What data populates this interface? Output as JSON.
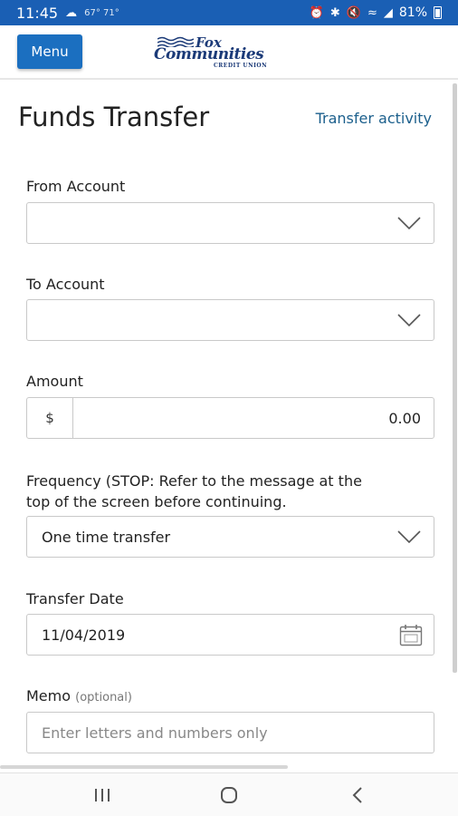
{
  "status": {
    "time": "11:45",
    "weather": "67° 71°",
    "battery": "81%"
  },
  "header": {
    "menu_label": "Menu",
    "logo_word1": "Fox",
    "logo_word2": "Communities",
    "logo_sub": "CREDIT UNION"
  },
  "page": {
    "title": "Funds Transfer",
    "activity_link": "Transfer activity"
  },
  "form": {
    "from_label": "From Account",
    "from_value": "",
    "to_label": "To Account",
    "to_value": "",
    "amount_label": "Amount",
    "amount_prefix": "$",
    "amount_value": "0.00",
    "frequency_label_line1": "Frequency (STOP: Refer to the message at the",
    "frequency_label_line2": "top of the screen before continuing.",
    "frequency_value": "One time transfer",
    "date_label": "Transfer Date",
    "date_value": "11/04/2019",
    "memo_label": "Memo",
    "memo_optional": "(optional)",
    "memo_placeholder": "Enter letters and numbers only"
  },
  "icons": {
    "dropdown": "chevron-down-icon",
    "calendar": "calendar-icon",
    "nav_recent": "recent-apps-icon",
    "nav_home": "home-icon",
    "nav_back": "back-icon"
  },
  "colors": {
    "status_bar": "#1a5fb4",
    "menu_button": "#1b6fc0",
    "link": "#1b5f8c",
    "logo": "#1b3a78"
  }
}
